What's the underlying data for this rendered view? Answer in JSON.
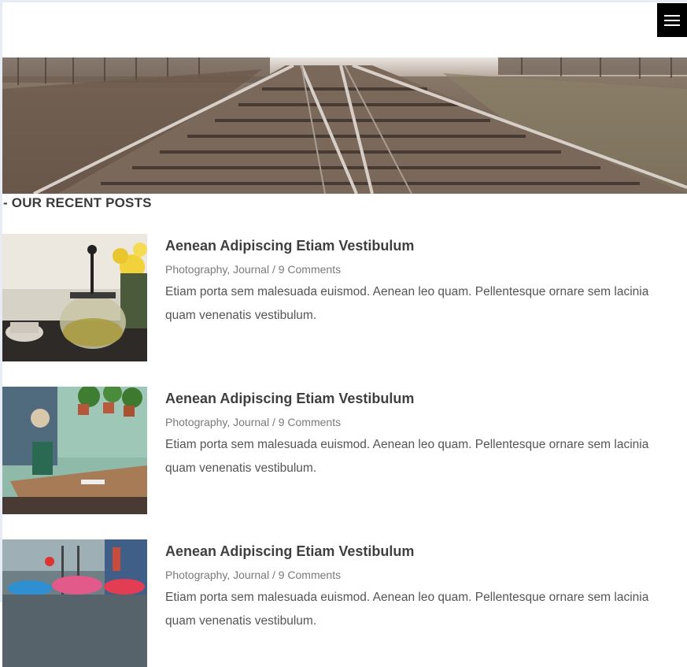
{
  "header": {
    "menu_icon": "hamburger-menu-icon"
  },
  "hero": {
    "image": "railway-tracks-photo"
  },
  "section": {
    "title": "- OUR RECENT POSTS"
  },
  "posts": [
    {
      "title": "Aenean Adipiscing Etiam Vestibulum",
      "category_1": "Photography",
      "category_2": "Journal",
      "separator": " / ",
      "comments": "9 Comments",
      "excerpt": "Etiam porta sem malesuada euismod. Aenean leo quam. Pellentesque ornare sem lacinia quam venenatis vestibulum.",
      "image": "teapot-photo"
    },
    {
      "title": "Aenean Adipiscing Etiam Vestibulum",
      "category_1": "Photography",
      "category_2": "Journal",
      "separator": " / ",
      "comments": "9 Comments",
      "excerpt": "Etiam porta sem malesuada euismod. Aenean leo quam. Pellentesque ornare sem lacinia quam venenatis vestibulum.",
      "image": "cafe-photo"
    },
    {
      "title": "Aenean Adipiscing Etiam Vestibulum",
      "category_1": "Photography",
      "category_2": "Journal",
      "separator": " / ",
      "comments": "9 Comments",
      "excerpt": "Etiam porta sem malesuada euismod. Aenean leo quam. Pellentesque ornare sem lacinia quam venenatis vestibulum.",
      "image": "umbrellas-street-photo"
    }
  ]
}
